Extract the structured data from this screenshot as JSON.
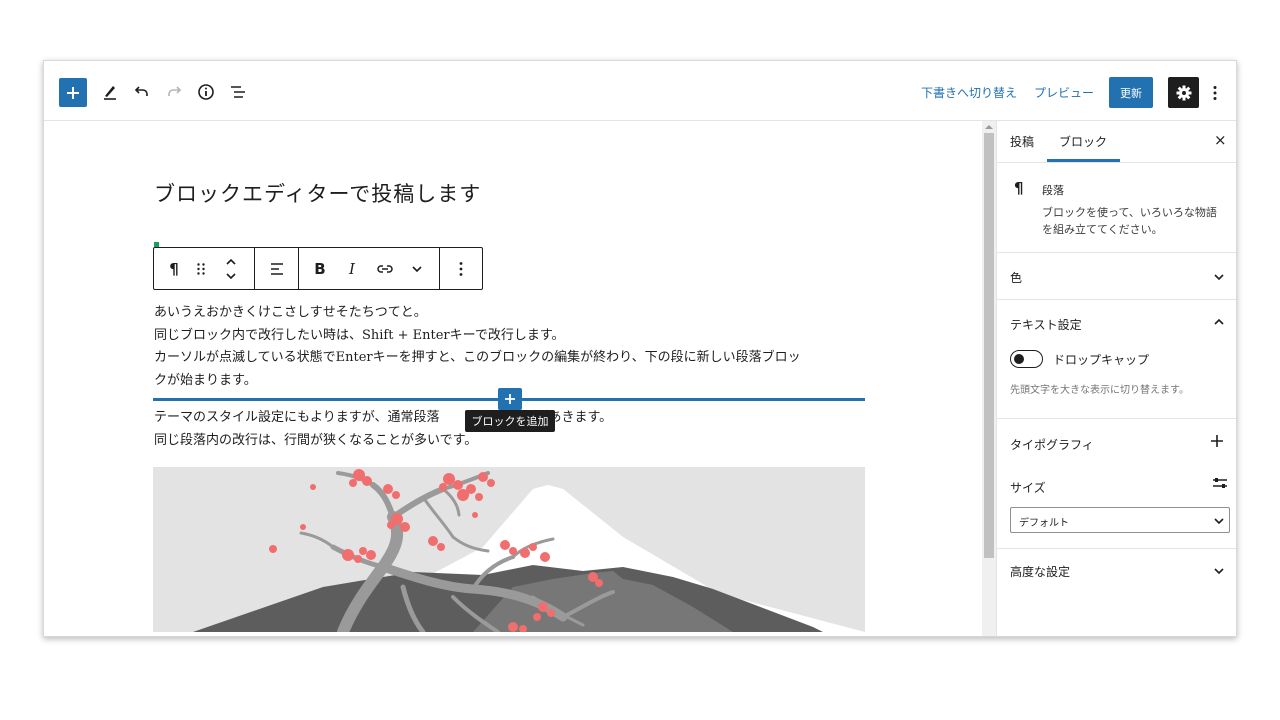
{
  "topbar": {
    "switch_to_draft": "下書きへ切り替え",
    "preview": "プレビュー",
    "update": "更新"
  },
  "editor": {
    "title": "ブロックエディターで投稿します",
    "paragraph1": [
      "あいうえおかきくけこさしすせそたちつてと。",
      "同じブロック内で改行したい時は、Shift + Enterキーで改行します。",
      "カーソルが点滅している状態でEnterキーを押すと、このブロックの編集が終わり、下の段に新しい段落ブロッ",
      "クが始まります。"
    ],
    "paragraph2": [
      "テーマのスタイル設定にもよりますが、通常段落",
      "間隔があきます。",
      "同じ段落内の改行は、行間が狭くなることが多いです。"
    ],
    "tooltip": "ブロックを追加",
    "block_toolbar": {
      "bold": "B",
      "italic": "I",
      "paragraph_symbol": "¶"
    }
  },
  "sidebar": {
    "tabs": [
      "投稿",
      "ブロック"
    ],
    "active_tab": "ブロック",
    "close": "×",
    "block_card": {
      "icon": "¶",
      "name": "段落",
      "description_line1": "ブロックを使って、いろいろな物語",
      "description_line2": "を組み立ててください。"
    },
    "panels": {
      "color": "色",
      "text_settings": "テキスト設定",
      "drop_cap_label": "ドロップキャップ",
      "drop_cap_help": "先頭文字を大きな表示に切り替えます。",
      "typography": "タイポグラフィ",
      "size": "サイズ",
      "size_select_value": "デフォルト",
      "advanced": "高度な設定"
    }
  },
  "colors": {
    "accent": "#2271b1",
    "dark": "#1e1e1e",
    "selected_dot": "#1a9e5c",
    "blossom": "#f16e6e"
  },
  "icons": [
    "plus-icon",
    "pencil-icon",
    "undo-icon",
    "redo-icon",
    "info-icon",
    "list-view-icon",
    "gear-icon",
    "kebab-icon",
    "drag-handle-icon",
    "move-arrows-icon",
    "align-icon",
    "link-icon",
    "chevron-down-icon",
    "chevron-up-icon",
    "close-icon",
    "sliders-icon"
  ]
}
